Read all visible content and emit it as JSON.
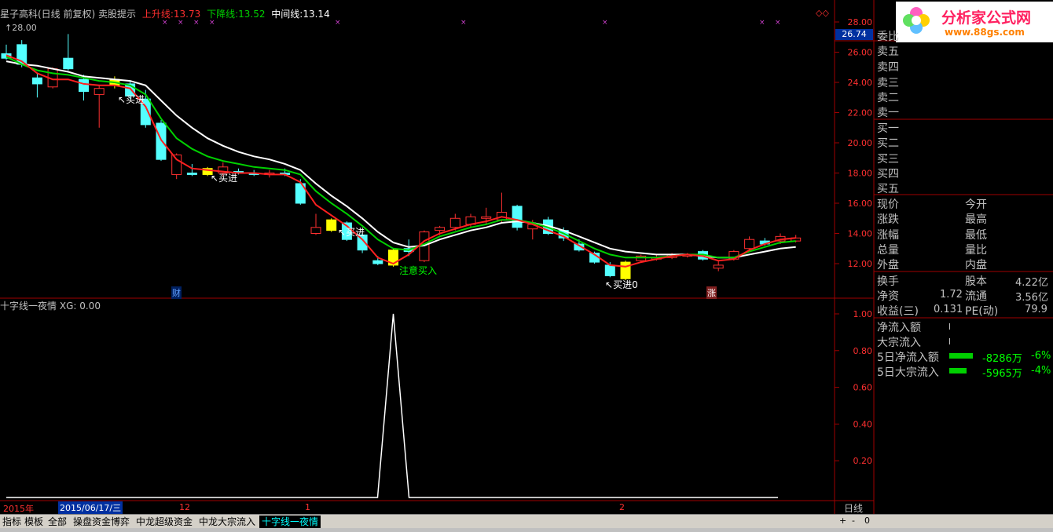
{
  "header": {
    "title": "星子高科(日线 前复权) 卖股提示",
    "up_label": "上升线:",
    "up_value": "13.73",
    "down_label": "下降线:",
    "down_value": "13.52",
    "mid_label": "中间线:",
    "mid_value": "13.14",
    "max_marker": "28.00",
    "colors": {
      "up": "#ff3030",
      "down": "#00d000",
      "mid": "#ffffff"
    }
  },
  "lower_header": {
    "name": "十字线一夜情",
    "xg_label": "XG:",
    "xg_value": "0.00"
  },
  "price_axis": {
    "ticks": [
      "28.00",
      "26.00",
      "24.00",
      "22.00",
      "20.00",
      "18.00",
      "16.00",
      "14.00",
      "12.00"
    ],
    "current": "26.74"
  },
  "lower_axis": {
    "ticks": [
      "1.00",
      "0.80",
      "0.60",
      "0.40",
      "0.20"
    ]
  },
  "time_axis": {
    "labels": [
      "2015年",
      "2015/06/17/三",
      "12",
      "1",
      "2"
    ],
    "period": "日线"
  },
  "annotations": {
    "buy": "买进",
    "attention": "注意买入",
    "buy_value": "买进0",
    "cai": "财",
    "zhang": "涨"
  },
  "logo": {
    "name": "分析家公式网",
    "url": "www.88gs.com"
  },
  "orderbook": {
    "weibi": "委比",
    "sells": [
      "卖五",
      "卖四",
      "卖三",
      "卖二",
      "卖一"
    ],
    "buys": [
      "买一",
      "买二",
      "买三",
      "买四",
      "买五"
    ]
  },
  "quote_left": [
    "现价",
    "涨跌",
    "涨幅",
    "总量",
    "外盘"
  ],
  "quote_right": [
    "今开",
    "最高",
    "最低",
    "量比",
    "内盘"
  ],
  "stats": {
    "huanshou": "换手",
    "guben": "股本",
    "guben_val": "4.22亿",
    "jingzi": "净资",
    "jingzi_val": "1.72",
    "liutong": "流通",
    "liutong_val": "3.56亿",
    "shouyi": "收益(三)",
    "shouyi_val": "0.131",
    "pe": "PE(动)",
    "pe_val": "79.9"
  },
  "flows": {
    "net": "净流入额",
    "big": "大宗流入",
    "net5": "5日净流入额",
    "net5_val": "-8286万",
    "net5_pct": "-6%",
    "big5": "5日大宗流入",
    "big5_val": "-5965万",
    "big5_pct": "-4%"
  },
  "tabs": [
    "指标",
    "模板",
    "全部",
    "操盘资金博弈",
    "中龙超级资金",
    "中龙大宗流入",
    "十字线一夜情"
  ],
  "zoom": {
    "plus": "+",
    "minus": "-",
    "zero": "0"
  },
  "chart_data": {
    "type": "candlestick",
    "ylim": [
      11,
      28.5
    ],
    "candles": [
      {
        "o": 25.9,
        "h": 26.5,
        "l": 25.5,
        "c": 25.6,
        "up": false
      },
      {
        "o": 26.5,
        "h": 26.8,
        "l": 25.0,
        "c": 25.2,
        "up": false
      },
      {
        "o": 24.3,
        "h": 24.6,
        "l": 23.0,
        "c": 23.9,
        "up": false
      },
      {
        "o": 23.7,
        "h": 25.0,
        "l": 23.6,
        "c": 24.9,
        "up": true
      },
      {
        "o": 25.6,
        "h": 27.2,
        "l": 24.8,
        "c": 24.9,
        "up": false
      },
      {
        "o": 24.2,
        "h": 24.5,
        "l": 22.8,
        "c": 23.4,
        "up": false
      },
      {
        "o": 23.2,
        "h": 23.8,
        "l": 21.0,
        "c": 23.6,
        "up": true
      },
      {
        "o": 24.2,
        "h": 24.4,
        "l": 23.6,
        "c": 23.8,
        "up": false,
        "mark": true
      },
      {
        "o": 23.9,
        "h": 24.1,
        "l": 22.9,
        "c": 23.1,
        "up": false
      },
      {
        "o": 22.9,
        "h": 23.5,
        "l": 21.0,
        "c": 21.2,
        "up": false
      },
      {
        "o": 21.3,
        "h": 21.5,
        "l": 18.8,
        "c": 18.9,
        "up": false
      },
      {
        "o": 17.9,
        "h": 19.3,
        "l": 17.6,
        "c": 19.2,
        "up": true
      },
      {
        "o": 18.0,
        "h": 18.6,
        "l": 17.8,
        "c": 17.9,
        "up": false
      },
      {
        "o": 18.3,
        "h": 18.4,
        "l": 17.8,
        "c": 17.9,
        "up": false,
        "mark": true
      },
      {
        "o": 18.0,
        "h": 18.7,
        "l": 17.8,
        "c": 18.4,
        "up": true
      },
      {
        "o": 18.1,
        "h": 18.3,
        "l": 17.9,
        "c": 18.0,
        "up": false
      },
      {
        "o": 18.0,
        "h": 18.2,
        "l": 17.8,
        "c": 17.9,
        "up": false
      },
      {
        "o": 17.9,
        "h": 18.2,
        "l": 17.7,
        "c": 18.0,
        "up": true
      },
      {
        "o": 18.0,
        "h": 18.3,
        "l": 17.8,
        "c": 17.9,
        "up": false
      },
      {
        "o": 17.3,
        "h": 17.6,
        "l": 15.9,
        "c": 16.0,
        "up": false
      },
      {
        "o": 14.0,
        "h": 15.3,
        "l": 13.9,
        "c": 14.4,
        "up": true
      },
      {
        "o": 14.9,
        "h": 15.0,
        "l": 14.1,
        "c": 14.2,
        "up": false,
        "mark": true
      },
      {
        "o": 14.7,
        "h": 14.8,
        "l": 13.5,
        "c": 13.6,
        "up": false
      },
      {
        "o": 13.9,
        "h": 14.0,
        "l": 12.7,
        "c": 12.9,
        "up": false
      },
      {
        "o": 12.2,
        "h": 12.5,
        "l": 11.9,
        "c": 12.0,
        "up": false
      },
      {
        "o": 12.9,
        "h": 13.0,
        "l": 11.8,
        "c": 11.9,
        "up": false,
        "mark": true
      },
      {
        "o": 12.8,
        "h": 13.6,
        "l": 12.5,
        "c": 13.0,
        "up": false
      },
      {
        "o": 12.2,
        "h": 14.2,
        "l": 12.1,
        "c": 14.1,
        "up": true
      },
      {
        "o": 14.2,
        "h": 14.5,
        "l": 13.9,
        "c": 14.4,
        "up": true
      },
      {
        "o": 14.4,
        "h": 15.3,
        "l": 14.2,
        "c": 15.0,
        "up": true
      },
      {
        "o": 14.6,
        "h": 15.3,
        "l": 14.4,
        "c": 15.1,
        "up": true
      },
      {
        "o": 15.0,
        "h": 15.7,
        "l": 14.6,
        "c": 15.1,
        "up": true
      },
      {
        "o": 14.9,
        "h": 16.7,
        "l": 14.7,
        "c": 15.4,
        "up": true
      },
      {
        "o": 15.8,
        "h": 15.9,
        "l": 14.2,
        "c": 14.4,
        "up": false
      },
      {
        "o": 14.3,
        "h": 14.9,
        "l": 13.6,
        "c": 14.6,
        "up": true
      },
      {
        "o": 14.9,
        "h": 15.1,
        "l": 13.9,
        "c": 14.0,
        "up": false
      },
      {
        "o": 14.2,
        "h": 14.4,
        "l": 13.5,
        "c": 13.7,
        "up": false
      },
      {
        "o": 13.3,
        "h": 13.6,
        "l": 12.8,
        "c": 12.9,
        "up": false
      },
      {
        "o": 12.7,
        "h": 12.8,
        "l": 12.0,
        "c": 12.1,
        "up": false
      },
      {
        "o": 11.9,
        "h": 12.1,
        "l": 11.1,
        "c": 11.2,
        "up": false
      },
      {
        "o": 12.1,
        "h": 12.2,
        "l": 10.9,
        "c": 11.0,
        "up": false,
        "mark": true
      },
      {
        "o": 12.2,
        "h": 12.6,
        "l": 12.1,
        "c": 12.5,
        "up": true
      },
      {
        "o": 12.3,
        "h": 12.6,
        "l": 12.2,
        "c": 12.4,
        "up": true
      },
      {
        "o": 12.4,
        "h": 12.7,
        "l": 12.3,
        "c": 12.6,
        "up": true
      },
      {
        "o": 12.5,
        "h": 12.7,
        "l": 12.4,
        "c": 12.6,
        "up": true
      },
      {
        "o": 12.8,
        "h": 12.9,
        "l": 12.2,
        "c": 12.3,
        "up": false
      },
      {
        "o": 11.9,
        "h": 12.2,
        "l": 11.5,
        "c": 11.7,
        "up": true
      },
      {
        "o": 12.3,
        "h": 12.9,
        "l": 12.2,
        "c": 12.8,
        "up": true
      },
      {
        "o": 13.0,
        "h": 13.8,
        "l": 12.9,
        "c": 13.6,
        "up": true
      },
      {
        "o": 13.5,
        "h": 13.7,
        "l": 13.2,
        "c": 13.3,
        "up": false
      },
      {
        "o": 13.5,
        "h": 14.0,
        "l": 13.3,
        "c": 13.8,
        "up": true
      },
      {
        "o": 13.5,
        "h": 13.9,
        "l": 13.4,
        "c": 13.7,
        "up": true
      }
    ],
    "red_line": [
      25.8,
      25.4,
      24.6,
      24.2,
      24.2,
      23.9,
      23.8,
      23.8,
      23.6,
      22.4,
      20.2,
      18.9,
      18.3,
      18.2,
      18.1,
      18.0,
      18.0,
      17.9,
      17.9,
      17.4,
      15.9,
      15.2,
      14.5,
      13.6,
      12.4,
      12.0,
      12.6,
      13.5,
      14.0,
      14.3,
      14.6,
      14.8,
      15.1,
      14.9,
      14.6,
      14.2,
      13.8,
      13.2,
      12.6,
      11.9,
      11.8,
      12.1,
      12.3,
      12.5,
      12.6,
      12.5,
      12.2,
      12.3,
      12.9,
      13.3,
      13.6,
      13.7
    ],
    "green_line": [
      25.7,
      25.2,
      24.8,
      24.6,
      24.5,
      24.3,
      24.1,
      24.0,
      23.8,
      23.2,
      21.6,
      20.3,
      19.6,
      19.1,
      18.8,
      18.6,
      18.4,
      18.3,
      18.2,
      17.9,
      16.8,
      16.0,
      15.3,
      14.5,
      13.6,
      13.0,
      12.9,
      13.3,
      13.8,
      14.1,
      14.4,
      14.6,
      14.9,
      14.9,
      14.7,
      14.4,
      14.0,
      13.5,
      13.0,
      12.6,
      12.4,
      12.4,
      12.4,
      12.5,
      12.6,
      12.6,
      12.4,
      12.4,
      12.8,
      13.1,
      13.4,
      13.5
    ],
    "white_line": [
      25.4,
      25.2,
      25.1,
      24.9,
      24.7,
      24.4,
      24.3,
      24.2,
      24.1,
      23.8,
      22.8,
      21.8,
      21.0,
      20.3,
      19.8,
      19.4,
      19.1,
      18.9,
      18.6,
      18.2,
      17.3,
      16.5,
      15.8,
      15.0,
      14.1,
      13.4,
      13.1,
      13.2,
      13.6,
      13.9,
      14.2,
      14.4,
      14.7,
      14.8,
      14.7,
      14.5,
      14.2,
      13.8,
      13.4,
      13.0,
      12.8,
      12.7,
      12.6,
      12.6,
      12.6,
      12.5,
      12.4,
      12.4,
      12.6,
      12.8,
      13.0,
      13.1
    ],
    "xg": {
      "ylim": [
        0,
        1.1
      ],
      "spike_index": 25,
      "spike_value": 1.0
    }
  }
}
